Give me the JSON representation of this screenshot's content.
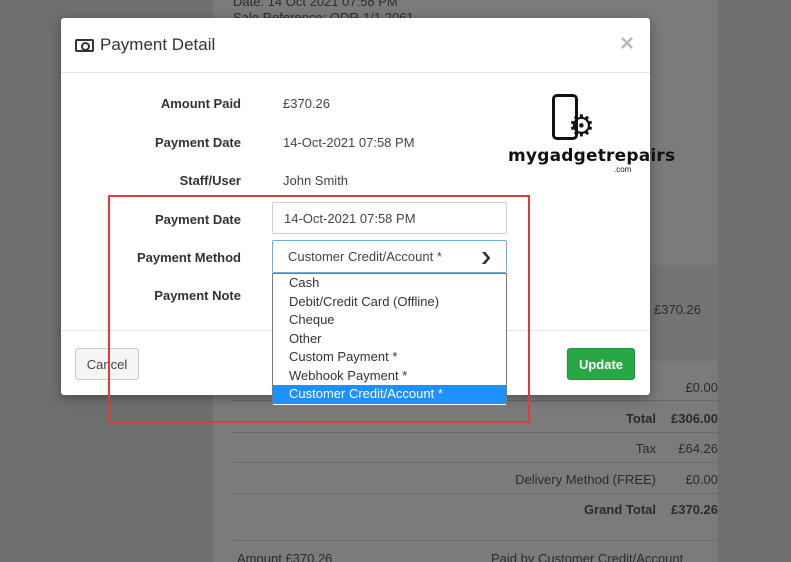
{
  "background": {
    "header_lines": [
      "Date: 14 Oct 2021 07:58 PM",
      "Sale Reference: ODR-1/1 2061"
    ],
    "first_amount": "£370.26",
    "totals": [
      {
        "label": "",
        "value": "£0.00",
        "bold": false
      },
      {
        "label": "Total",
        "value": "£306.00",
        "bold": true
      },
      {
        "label": "Tax",
        "value": "£64.26",
        "bold": false
      },
      {
        "label": "Delivery Method (FREE)",
        "value": "£0.00",
        "bold": false
      },
      {
        "label": "Grand Total",
        "value": "£370.26",
        "bold": true
      }
    ],
    "footer_left": "Amount £370.26",
    "footer_right": "Paid by Customer Credit/Account"
  },
  "modal": {
    "title": "Payment Detail",
    "title_icon": "money-bill-icon",
    "close_glyph": "×",
    "fields": {
      "amount_paid_label": "Amount Paid",
      "amount_paid_value": "£370.26",
      "payment_date_label": "Payment Date",
      "payment_date_value": "14-Oct-2021 07:58 PM",
      "staff_label": "Staff/User",
      "staff_value": "John Smith"
    },
    "form": {
      "payment_date_label": "Payment Date",
      "payment_date_input": "14-Oct-2021 07:58 PM",
      "payment_method_label": "Payment Method",
      "payment_method_selected": "Customer Credit/Account *",
      "payment_note_label": "Payment Note",
      "payment_method_options": [
        "Cash",
        "Debit/Credit Card (Offline)",
        "Cheque",
        "Other",
        "Custom Payment *",
        "Webhook Payment *",
        "Customer Credit/Account *"
      ],
      "selected_index": 6
    },
    "cancel_label": "Cancel",
    "update_label": "Update"
  },
  "logo": {
    "text": "mygadgetrepairs",
    "suffix": ".com",
    "icon": "phone-gear-icon"
  },
  "colors": {
    "update_button": "#28a745",
    "highlight_box": "#e0393e",
    "selected_option": "#1e90ff",
    "focus_border": "#66afe9"
  }
}
